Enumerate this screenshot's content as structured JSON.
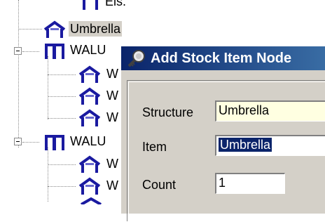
{
  "tree": {
    "top_partial": "Eis.",
    "nodes": [
      {
        "label": "Umbrella",
        "selected": true
      },
      {
        "label": "WALU"
      },
      {
        "label": "W"
      },
      {
        "label": "W"
      },
      {
        "label": "W"
      },
      {
        "label": "WALU"
      },
      {
        "label": "W"
      },
      {
        "label": "W"
      }
    ]
  },
  "dialog": {
    "title": "Add Stock Item Node",
    "structure_label": "Structure",
    "structure_value": "Umbrella",
    "item_label": "Item",
    "item_value": "Umbrella",
    "count_label": "Count",
    "count_value": "1"
  },
  "colors": {
    "titlebar_start": "#0a246a",
    "titlebar_end": "#3a6ea5",
    "dialog_bg": "#d4d0c8",
    "readonly_field_bg": "#ffffe1",
    "tree_selection_bg": "#d4d0c8",
    "icon_blue": "#1a1aa0"
  },
  "icons": {
    "structure": "umbrella-structure-icon",
    "group": "rack-icon",
    "dialog": "key-magnifier-icon",
    "expander": "minus-box-icon"
  }
}
